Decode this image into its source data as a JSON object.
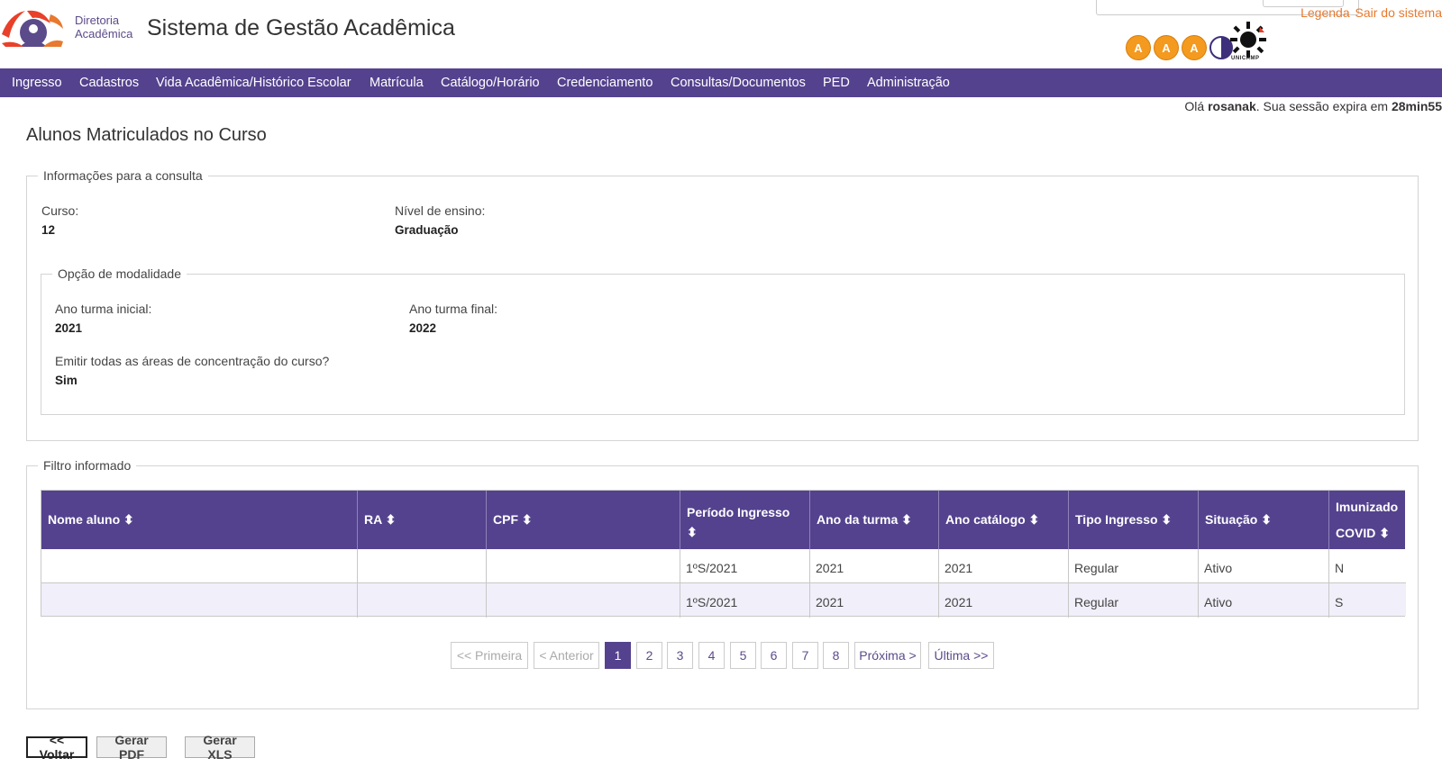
{
  "header": {
    "dir_line1": "Diretoria",
    "dir_line2": "Acadêmica",
    "app_title": "Sistema de Gestão Acadêmica",
    "link_legend": "Legenda",
    "link_logout": "Sair do sistema",
    "a11y": {
      "a1": "A",
      "a2": "A",
      "a3": "A"
    },
    "unicamp_label": "UNICAMP",
    "colors": {
      "brand": "#54428e",
      "accent": "#e8792e",
      "a11y_orange": "#f39a1f"
    }
  },
  "nav": [
    "Ingresso",
    "Cadastros",
    "Vida Acadêmica/Histórico Escolar",
    "Matrícula",
    "Catálogo/Horário",
    "Credenciamento",
    "Consultas/Documentos",
    "PED",
    "Administração"
  ],
  "session": {
    "greeting": "Olá",
    "user": "rosanak",
    "expires_text": ". Sua sessão expira em",
    "expires_value": "28min55"
  },
  "page_title": "Alunos Matriculados no Curso",
  "info": {
    "legend": "Informações para a consulta",
    "curso_label": "Curso:",
    "curso_value": "12",
    "nivel_label": "Nível de ensino:",
    "nivel_value": "Graduação",
    "modalidade": {
      "legend": "Opção de modalidade",
      "ano_inicial_label": "Ano turma inicial:",
      "ano_inicial_value": "2021",
      "ano_final_label": "Ano turma final:",
      "ano_final_value": "2022",
      "areas_label": "Emitir todas as áreas de concentração do curso?",
      "areas_value": "Sim"
    }
  },
  "filter": {
    "legend": "Filtro informado",
    "sort_icon": "⬍",
    "columns": [
      "Nome aluno ⬍",
      "RA ⬍",
      "CPF ⬍",
      "Período Ingresso",
      "Ano da turma ⬍",
      "Ano catálogo ⬍",
      "Tipo Ingresso ⬍",
      "Situação ⬍",
      "Imunizado"
    ],
    "col4_line2": "⬍",
    "col9_line2": "COVID ⬍",
    "rows": [
      {
        "nome": "",
        "ra": "",
        "cpf": "",
        "periodo": "1ºS/2021",
        "ano_turma": "2021",
        "ano_catalogo": "2021",
        "tipo": "Regular",
        "situacao": "Ativo",
        "imunizado": "N"
      },
      {
        "nome": "",
        "ra": "",
        "cpf": "",
        "periodo": "1ºS/2021",
        "ano_turma": "2021",
        "ano_catalogo": "2021",
        "tipo": "Regular",
        "situacao": "Ativo",
        "imunizado": "S"
      }
    ],
    "pagination": {
      "first": "<< Primeira",
      "prev": "< Anterior",
      "pages": [
        "1",
        "2",
        "3",
        "4",
        "5",
        "6",
        "7",
        "8"
      ],
      "current": "1",
      "next": "Próxima >",
      "last": "Última >>"
    }
  },
  "actions": {
    "back": "<< Voltar",
    "pdf": "Gerar PDF",
    "xls": "Gerar XLS"
  }
}
